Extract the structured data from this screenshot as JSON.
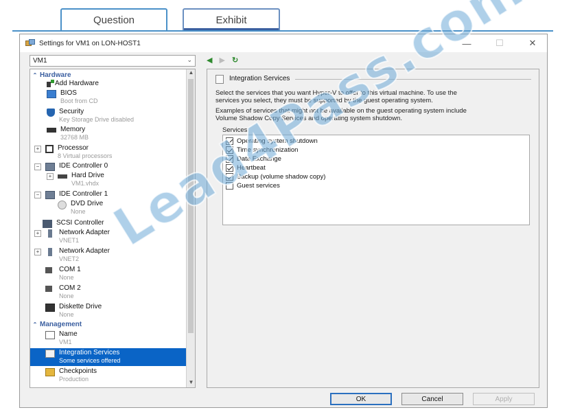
{
  "tabs": {
    "question": "Question",
    "exhibit": "Exhibit"
  },
  "window": {
    "title": "Settings for VM1 on LON-HOST1",
    "min": "—",
    "max": "☐",
    "close": "✕"
  },
  "vm_select": {
    "value": "VM1"
  },
  "tree": {
    "hardware_header": "Hardware",
    "add_hardware": "Add Hardware",
    "bios": {
      "label": "BIOS",
      "sub": "Boot from CD"
    },
    "security": {
      "label": "Security",
      "sub": "Key Storage Drive disabled"
    },
    "memory": {
      "label": "Memory",
      "sub": "32768 MB"
    },
    "processor": {
      "label": "Processor",
      "sub": "8 Virtual processors"
    },
    "ide0": {
      "label": "IDE Controller 0"
    },
    "hard_drive": {
      "label": "Hard Drive",
      "sub": "VM1.vhdx"
    },
    "ide1": {
      "label": "IDE Controller 1"
    },
    "dvd": {
      "label": "DVD Drive",
      "sub": "None"
    },
    "scsi": {
      "label": "SCSI Controller"
    },
    "net1": {
      "label": "Network Adapter",
      "sub": "VNET1"
    },
    "net2": {
      "label": "Network Adapter",
      "sub": "VNET2"
    },
    "com1": {
      "label": "COM 1",
      "sub": "None"
    },
    "com2": {
      "label": "COM 2",
      "sub": "None"
    },
    "diskette": {
      "label": "Diskette Drive",
      "sub": "None"
    },
    "management_header": "Management",
    "name": {
      "label": "Name",
      "sub": "VM1"
    },
    "integration": {
      "label": "Integration Services",
      "sub": "Some services offered"
    },
    "checkpoints": {
      "label": "Checkpoints",
      "sub": "Production"
    }
  },
  "nav": {
    "back": "◀",
    "forward": "▶",
    "refresh": "↻"
  },
  "integration_panel": {
    "heading": "Integration Services",
    "para1_line1": "Select the services that you want Hyper-V to offer to this virtual machine. To use the",
    "para1_line2": "services you select, they must be supported by the guest operating system.",
    "para2_line1": "Examples of services that might not be available on the guest operating system include",
    "para2_line2": "Volume Shadow Copy Services and operating system shutdown.",
    "services_label": "Services",
    "services": [
      {
        "name": "Operating system shutdown",
        "checked": true
      },
      {
        "name": "Time synchronization",
        "checked": true
      },
      {
        "name": "Data Exchange",
        "checked": true
      },
      {
        "name": "Heartbeat",
        "checked": true
      },
      {
        "name": "Backup (volume shadow copy)",
        "checked": true
      },
      {
        "name": "Guest services",
        "checked": false
      }
    ]
  },
  "buttons": {
    "ok": "OK",
    "cancel": "Cancel",
    "apply": "Apply"
  },
  "watermark": "Lead4Pass.com"
}
